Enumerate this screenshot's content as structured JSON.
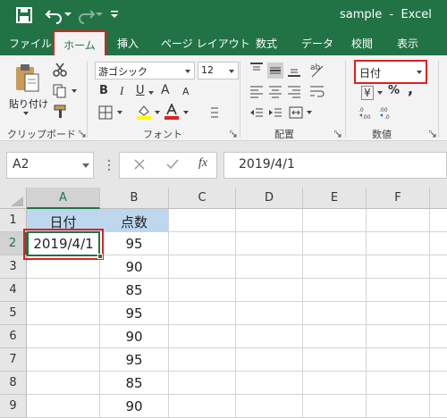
{
  "window": {
    "title": "sample  -  Excel"
  },
  "tabs": {
    "file": "ファイル",
    "home": "ホーム",
    "insert": "挿入",
    "page_layout": "ページ レイアウト",
    "formulas": "数式",
    "data": "データ",
    "review": "校閲",
    "view": "表示"
  },
  "ribbon": {
    "clipboard": {
      "paste_label": "貼り付け",
      "group_label": "クリップボード"
    },
    "font": {
      "font_name": "游ゴシック",
      "font_size": "12",
      "bold": "B",
      "italic": "I",
      "underline": "U",
      "grow": "A",
      "shrink": "A",
      "group_label": "フォント"
    },
    "alignment": {
      "group_label": "配置"
    },
    "number": {
      "format_value": "日付",
      "currency": "¥",
      "percent": "%",
      "comma": ",",
      "group_label": "数値"
    }
  },
  "formula_bar": {
    "name_box": "A2",
    "fx": "fx",
    "value": "2019/4/1"
  },
  "sheet": {
    "columns": [
      "A",
      "B",
      "C",
      "D",
      "E",
      "F"
    ],
    "rows": [
      "1",
      "2",
      "3",
      "4",
      "5",
      "6",
      "7",
      "8",
      "9"
    ],
    "A": [
      "日付",
      "2019/4/1",
      "",
      "",
      "",
      "",
      "",
      "",
      ""
    ],
    "B": [
      "点数",
      "95",
      "90",
      "85",
      "95",
      "90",
      "95",
      "85",
      "90"
    ]
  },
  "colors": {
    "excel_green": "#217346",
    "header_fill": "#bdd7ee",
    "highlight_red": "#e02020"
  }
}
